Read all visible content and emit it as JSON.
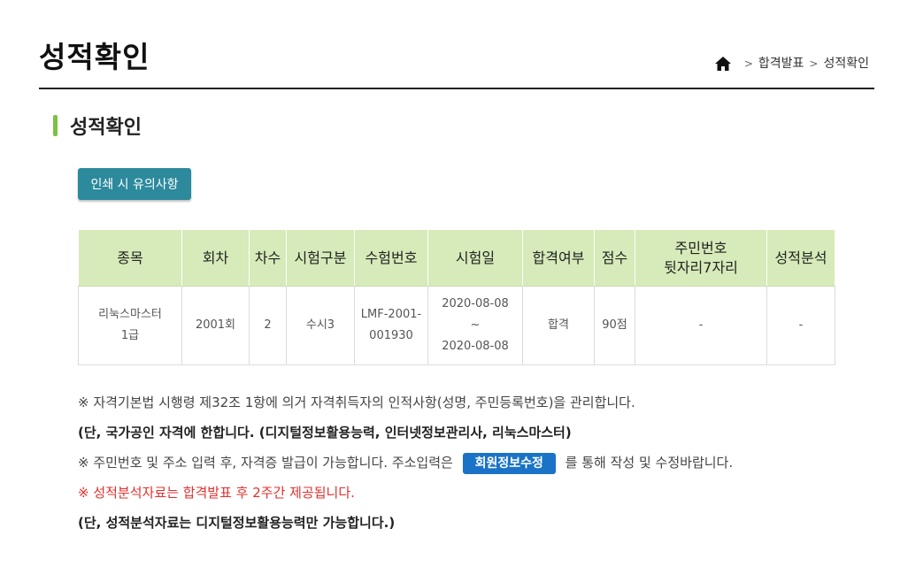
{
  "header": {
    "title": "성적확인",
    "breadcrumb": [
      "합격발표",
      "성적확인"
    ],
    "breadcrumb_sep": ">"
  },
  "section": {
    "title": "성적확인"
  },
  "print_button": {
    "label": "인쇄 시 유의사항"
  },
  "table": {
    "headers": [
      "종목",
      "회차",
      "차수",
      "시험구분",
      "수험번호",
      "시험일",
      "합격여부",
      "점수",
      "주민번호\n뒷자리7자리",
      "성적분석"
    ],
    "row": {
      "subject": "리눅스마스터\n1급",
      "round": "2001회",
      "order": "2",
      "exam_type": "수시3",
      "exam_number": "LMF-2001-\n001930",
      "exam_date": "2020-08-08\n~\n2020-08-08",
      "pass": "합격",
      "score": "90점",
      "resident_no": "-",
      "analysis": "-"
    }
  },
  "notes": {
    "line1": "※ 자격기본법 시행령 제32조 1항에 의거 자격취득자의 인적사항(성명, 주민등록번호)을 관리합니다.",
    "line2": "(단, 국가공인 자격에 한합니다. (디지털정보활용능력, 인터넷정보관리사, 리눅스마스터)",
    "line3_pre": "※ 주민번호 및 주소 입력 후, 자격증 발급이 가능합니다. 주소입력은",
    "line3_button": "회원정보수정",
    "line3_post": "를 통해 작성 및 수정바랍니다.",
    "line4": "※ 성적분석자료는 합격발표 후 2주간 제공됩니다.",
    "line5": "(단, 성적분석자료는 디지털정보활용능력만 가능합니다.)"
  },
  "colors": {
    "accent_green": "#7dc143",
    "header_green": "#d6ebb9",
    "print_btn": "#2c8a9c",
    "member_btn": "#1a73c6",
    "notice_red": "#e0312e"
  },
  "icons": {
    "home": "home-icon"
  }
}
